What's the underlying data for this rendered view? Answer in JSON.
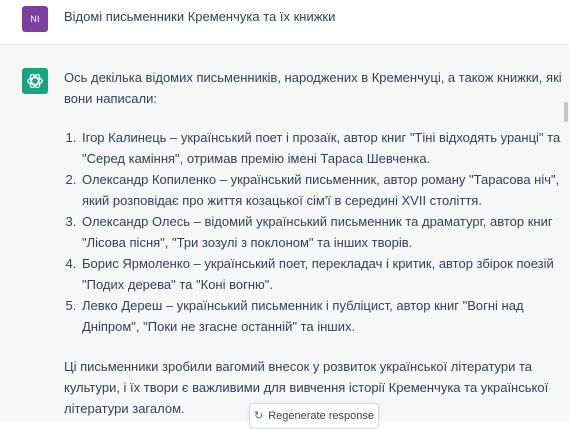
{
  "user_message": {
    "avatar_initials": "NI",
    "text": "Відомі письменники Кременчука та їх книжки"
  },
  "assistant_message": {
    "avatar_icon": "openai-logo-icon",
    "intro": "Ось декілька відомих письменників, народжених в Кременчуці, а також книжки, які вони написали:",
    "items": [
      "Ігор Калинець – український поет і прозаїк, автор книг \"Тіні відходять уранці\" та \"Серед каміння\", отримав премію імені Тараса Шевченка.",
      "Олександр Копиленко – український письменник, автор роману \"Тарасова ніч\", який розповідає про життя козацької сім'ї в середині XVII століття.",
      "Олександр Олесь – відомий український письменник та драматург, автор книг \"Лісова пісня\", \"Три зозулі з поклоном\" та інших творів.",
      "Борис Ярмоленко – український поет, перекладач і критик, автор збірок поезій \"Подих дерева\" та \"Коні вогню\".",
      "Левко Дереш – український письменник і публіцист, автор книг \"Вогні над Дніпром\", \"Поки не згасне останній\" та інших."
    ],
    "outro": "Ці письменники зробили вагомий внесок у розвиток української літератури та культури, і їх твори є важливими для вивчення історії Кременчука та української літератури загалом."
  },
  "regenerate": {
    "icon": "refresh-icon",
    "label": "Regenerate response"
  },
  "colors": {
    "user_avatar": "#7b3fa0",
    "bot_avatar": "#19a37f",
    "assistant_bg": "#f7f7f8"
  }
}
